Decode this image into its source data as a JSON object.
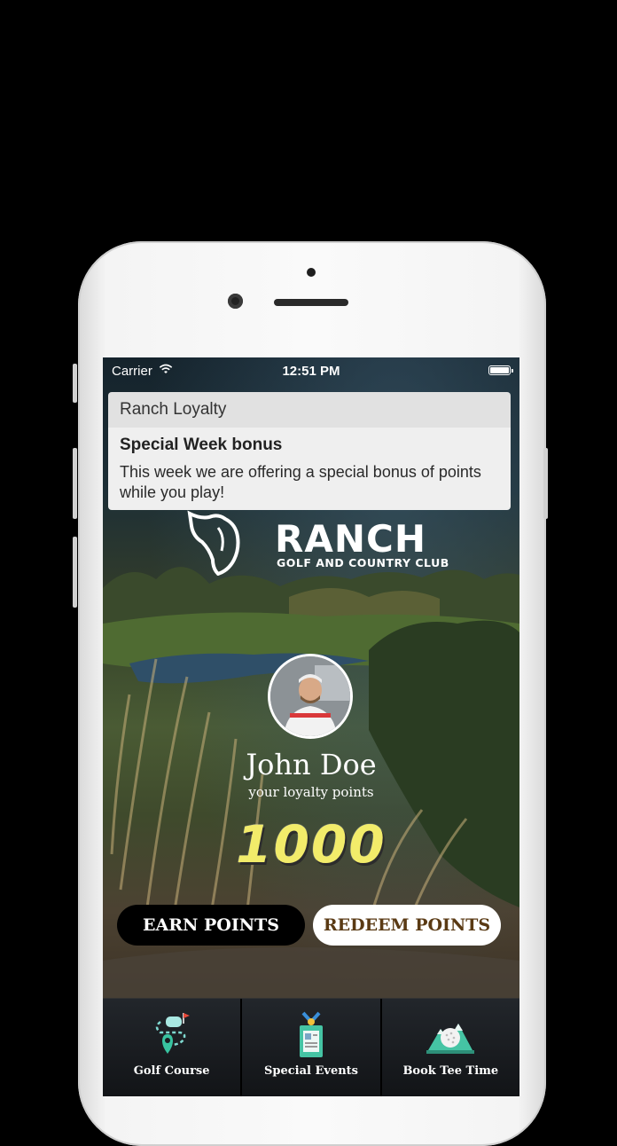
{
  "status_bar": {
    "carrier": "Carrier",
    "time": "12:51 PM",
    "wifi_icon": "wifi-icon",
    "battery_icon": "battery-icon"
  },
  "notification": {
    "app_name": "Ranch Loyalty",
    "title": "Special Week bonus",
    "message": "This week we are offering a special bonus of points while you play!"
  },
  "logo": {
    "title": "RANCH",
    "subtitle": "GOLF AND COUNTRY CLUB"
  },
  "profile": {
    "name": "John Doe",
    "points_caption": "your loyalty points",
    "points": "1000"
  },
  "actions": {
    "earn_label": "EARN POINTS",
    "redeem_label": "REDEEM POINTS"
  },
  "bottom_nav": {
    "items": [
      {
        "label": "Golf Course",
        "icon": "golf-course-map-icon"
      },
      {
        "label": "Special Events",
        "icon": "event-badge-icon"
      },
      {
        "label": "Book Tee Time",
        "icon": "golf-ball-tee-icon"
      }
    ]
  },
  "colors": {
    "points_yellow": "#f2ec6a",
    "redeem_text": "#5a3a14",
    "nav_background": "#1a1d21"
  }
}
